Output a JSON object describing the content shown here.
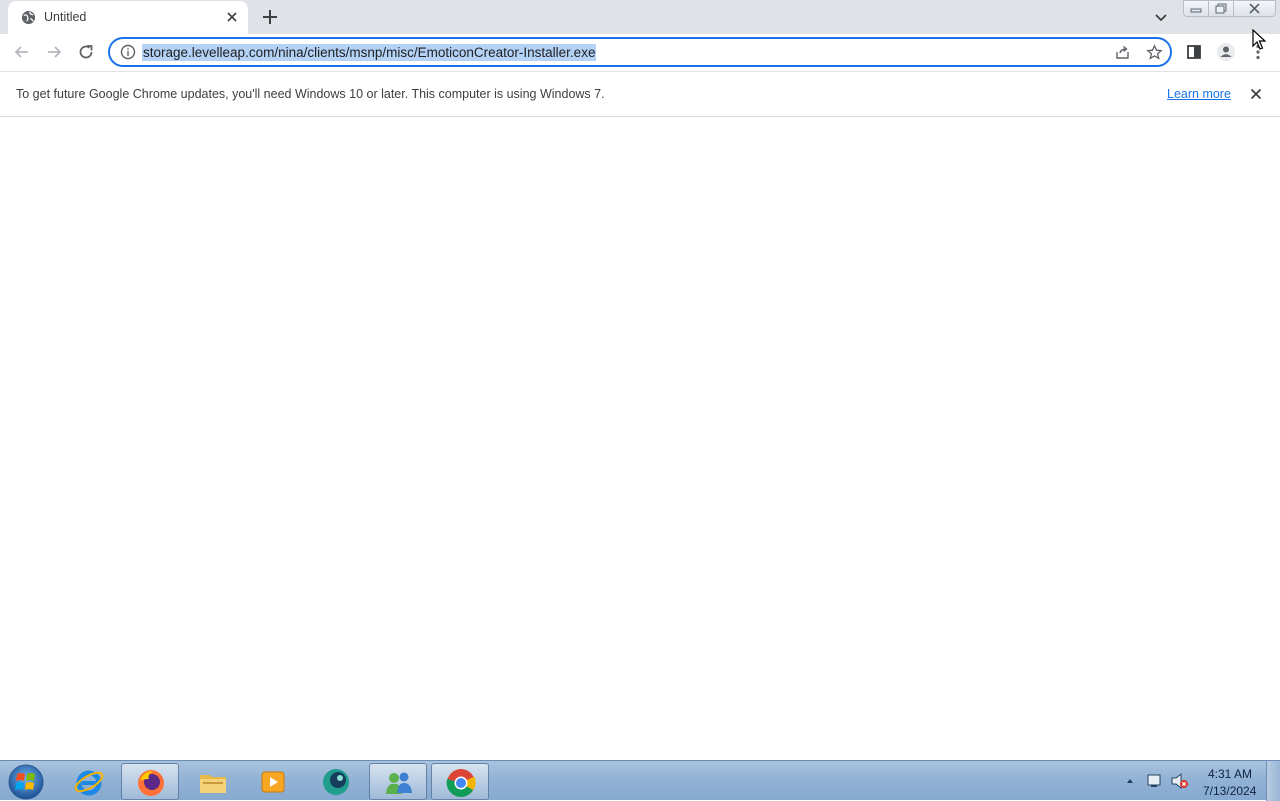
{
  "tab": {
    "title": "Untitled"
  },
  "omnibox": {
    "url": "storage.levelleap.com/nina/clients/msnp/misc/EmoticonCreator-Installer.exe"
  },
  "infobar": {
    "message": "To get future Google Chrome updates, you'll need Windows 10 or later. This computer is using Windows 7.",
    "link": "Learn more"
  },
  "taskbar": {
    "items": [
      {
        "icon": "internet-explorer-icon"
      },
      {
        "icon": "firefox-icon"
      },
      {
        "icon": "file-explorer-icon"
      },
      {
        "icon": "media-player-icon"
      },
      {
        "icon": "app-teal-icon"
      },
      {
        "icon": "messenger-icon"
      },
      {
        "icon": "chrome-icon"
      }
    ],
    "clock_time": "4:31 AM",
    "clock_date": "7/13/2024"
  },
  "colors": {
    "accent": "#1a73e8",
    "selection": "#b4d2f5",
    "taskbar": "#93b3d5"
  }
}
